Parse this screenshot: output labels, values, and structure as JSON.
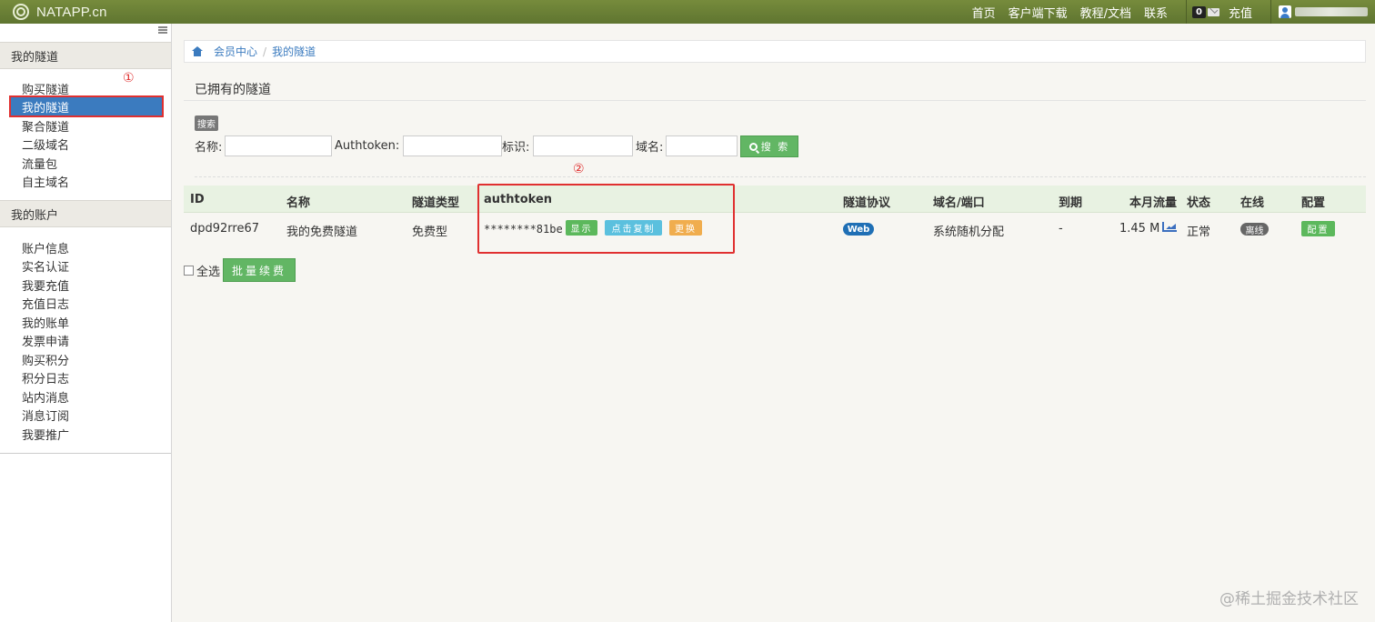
{
  "brand": {
    "name": "NATAPP.cn"
  },
  "topnav": {
    "links": [
      "首页",
      "客户端下载",
      "教程/文档",
      "联系"
    ],
    "message_count": "0",
    "recharge": "充值"
  },
  "sidebar": {
    "section1_title": "我的隧道",
    "section1_items": [
      "购买隧道",
      "我的隧道",
      "聚合隧道",
      "二级域名",
      "流量包",
      "自主域名"
    ],
    "section2_title": "我的账户",
    "section2_items": [
      "账户信息",
      "实名认证",
      "我要充值",
      "充值日志",
      "我的账单",
      "发票申请",
      "购买积分",
      "积分日志",
      "站内消息",
      "消息订阅",
      "我要推广"
    ],
    "active_item": "我的隧道"
  },
  "annotations": {
    "marker1": "①",
    "marker2": "②"
  },
  "breadcrumb": [
    "会员中心",
    "我的隧道"
  ],
  "page_title": "已拥有的隧道",
  "search": {
    "tag": "搜索",
    "name_label": "名称:",
    "authtoken_label": "Authtoken:",
    "tag_label": "标识:",
    "domain_label": "域名:",
    "button": "搜 索"
  },
  "table": {
    "headers": [
      "ID",
      "名称",
      "隧道类型",
      "authtoken",
      "隧道协议",
      "域名/端口",
      "到期",
      "本月流量",
      "状态",
      "在线",
      "配置"
    ],
    "row": {
      "id": "dpd92rre67",
      "name": "我的免费隧道",
      "type": "免费型",
      "authtoken": "********81be",
      "btn_show": "显示",
      "btn_copy": "点击复制",
      "btn_replace": "更换",
      "protocol": "Web",
      "domain": "系统随机分配",
      "expire": "-",
      "traffic": "1.45 M",
      "status": "正常",
      "online": "离线",
      "config": "配置"
    }
  },
  "footer": {
    "select_all": "全选",
    "batch_renew": "批量续费"
  },
  "watermark": "@稀土掘金技术社区",
  "colors": {
    "navbar": "#6b8034",
    "active": "#3b7bbf",
    "success": "#5cb85c",
    "info": "#5bc0de",
    "warning": "#f0ad4e",
    "highlight": "#e03030"
  }
}
